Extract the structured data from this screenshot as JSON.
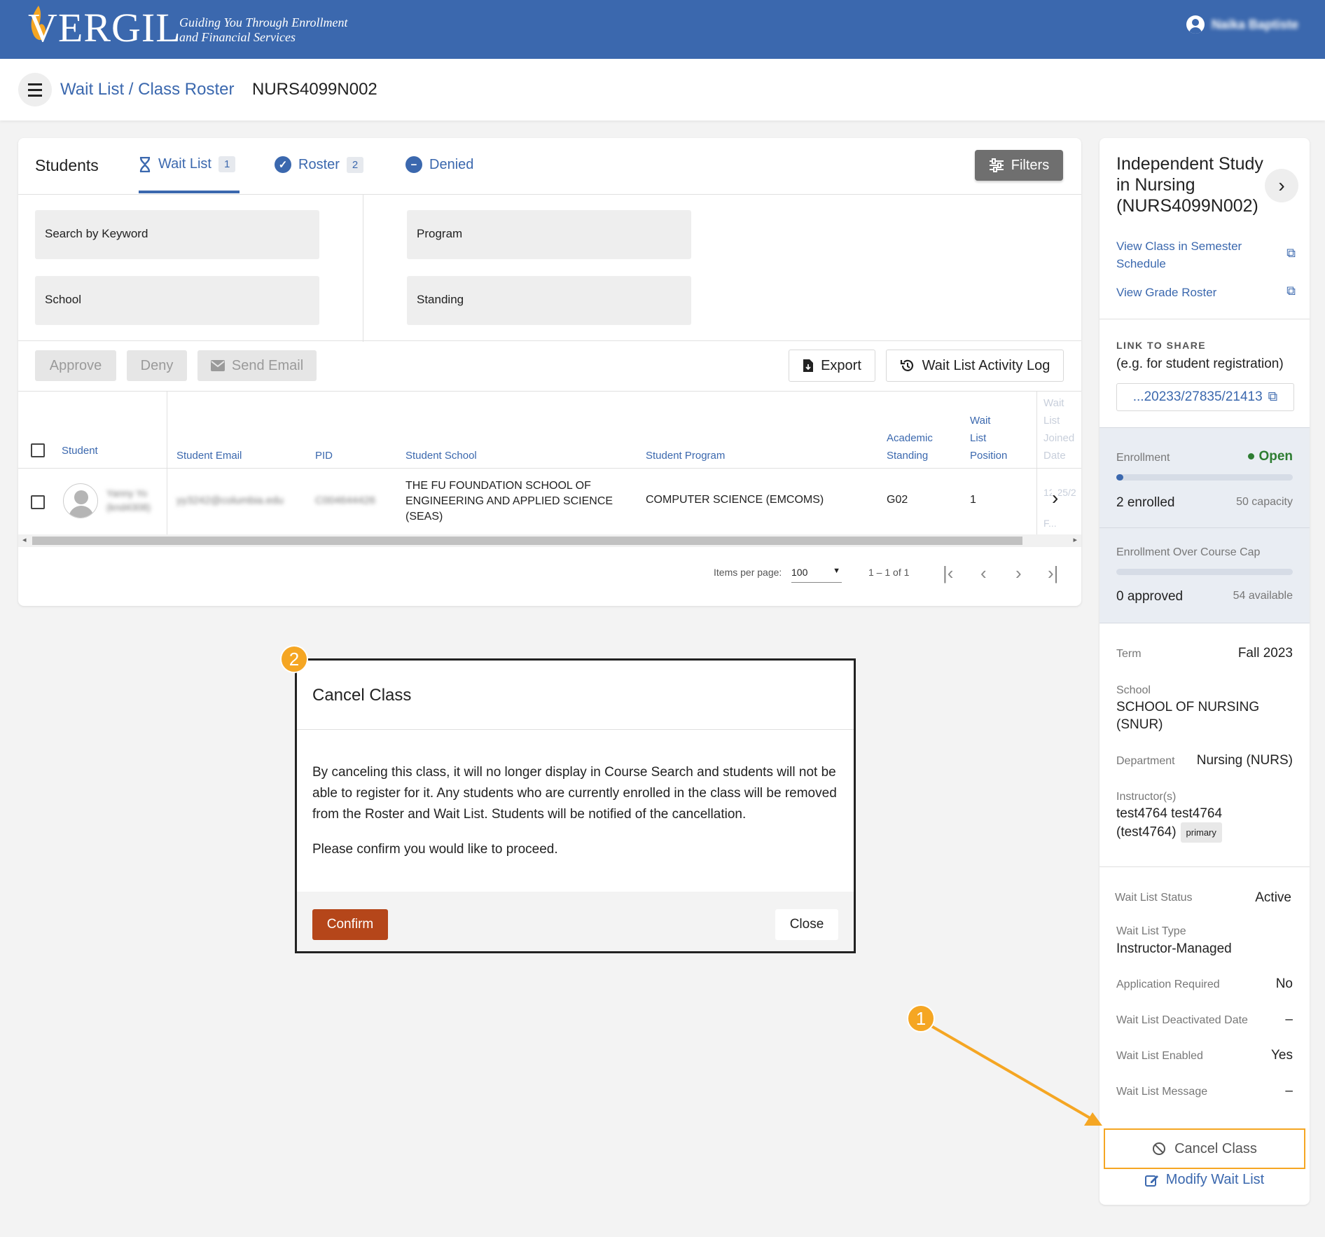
{
  "header": {
    "logo_text": "VERGIL",
    "tagline_line1": "Guiding You Through Enrollment",
    "tagline_line2": "and Financial Services",
    "user_name": "Naika Baptiste"
  },
  "breadcrumb": {
    "link": "Wait List / Class Roster",
    "course_code": "NURS4099N002"
  },
  "tabs": {
    "title": "Students",
    "items": [
      {
        "label": "Wait List",
        "count": "1"
      },
      {
        "label": "Roster",
        "count": "2"
      },
      {
        "label": "Denied"
      }
    ],
    "filters_label": "Filters"
  },
  "filters": {
    "keyword": "Search by Keyword",
    "school": "School",
    "program": "Program",
    "standing": "Standing"
  },
  "actions": {
    "approve": "Approve",
    "deny": "Deny",
    "send_email": "Send Email",
    "export": "Export",
    "activity_log": "Wait List Activity Log"
  },
  "table": {
    "headers": {
      "student": "Student",
      "email": "Student Email",
      "pid": "PID",
      "school": "Student School",
      "program": "Student Program",
      "standing_1": "Academic",
      "standing_2": "Standing",
      "position_1": "Wait",
      "position_2": "List",
      "position_3": "Position",
      "joined_1": "Wait",
      "joined_2": "List",
      "joined_3": "Joined",
      "joined_4": "Date"
    },
    "rows": [
      {
        "name_1": "Yanny Yo",
        "name_2": "(knd4308)",
        "email": "yy3242@columbia.edu",
        "pid": "C004644426",
        "school_1": "THE FU FOUNDATION SCHOOL OF",
        "school_2": "ENGINEERING AND APPLIED SCIENCE",
        "school_3": "(SEAS)",
        "program": "COMPUTER SCIENCE (EMCOMS)",
        "standing": "G02",
        "position": "1",
        "joined_1": "12/25/2",
        "joined_2": "F..."
      }
    ]
  },
  "pagination": {
    "items_per_page_label": "Items per page:",
    "items_per_page": "100",
    "range": "1 – 1 of 1"
  },
  "sidebar": {
    "course_title": "Independent Study in Nursing (NURS4099N002)",
    "view_schedule": "View Class in Semester Schedule",
    "view_grade_roster": "View Grade Roster",
    "link_to_share_label": "LINK TO SHARE",
    "link_to_share_hint": "(e.g. for student registration)",
    "link_value": "...20233/27835/21413",
    "enrollment_label": "Enrollment",
    "enrollment_status": "Open",
    "enrolled": "2 enrolled",
    "capacity": "50 capacity",
    "enrollment_fraction": 0.04,
    "over_cap_label": "Enrollment Over Course Cap",
    "approved": "0 approved",
    "available": "54 available",
    "over_cap_fraction": 0,
    "term_label": "Term",
    "term": "Fall 2023",
    "school_label": "School",
    "school": "SCHOOL OF NURSING (SNUR)",
    "department_label": "Department",
    "department": "Nursing (NURS)",
    "instructors_label": "Instructor(s)",
    "instructor": "test4764 test4764 (test4764)",
    "instructor_badge": "primary",
    "wl_status_label": "Wait List Status",
    "wl_status": "Active",
    "wl_type_label": "Wait List Type",
    "wl_type": "Instructor-Managed",
    "app_required_label": "Application Required",
    "app_required": "No",
    "deactivated_label": "Wait List Deactivated Date",
    "deactivated": "–",
    "enabled_label": "Wait List Enabled",
    "enabled": "Yes",
    "message_label": "Wait List Message",
    "message": "–",
    "cancel_class": "Cancel Class",
    "modify_wait_list": "Modify Wait List"
  },
  "modal": {
    "title": "Cancel Class",
    "body_1": "By canceling this class, it will no longer display in Course Search and students will not be able to register for it. Any students who are currently enrolled in the class will be removed from the Roster and Wait List. Students will be notified of the cancellation.",
    "body_2": "Please confirm you would like to proceed.",
    "confirm": "Confirm",
    "close": "Close"
  },
  "annotations": {
    "step_1": "1",
    "step_2": "2"
  },
  "colors": {
    "brand_blue": "#3b68ae",
    "accent_orange": "#f5a623",
    "confirm_red": "#b5461a",
    "open_green": "#2e7d32"
  }
}
